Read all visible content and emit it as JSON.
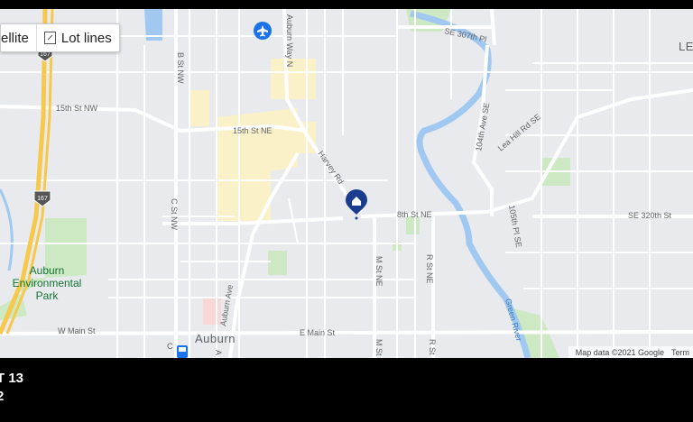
{
  "map": {
    "layer_toggle": {
      "satellite_label": "ellite",
      "lot_lines_label": "Lot lines"
    },
    "streets": {
      "se_307th_pl": "SE 307th Pl",
      "auburn_way_n": "Auburn Way N",
      "b_st_nw": "B St NW",
      "15th_st_nw": "15th St NW",
      "15th_st_ne": "15th St NE",
      "harvey_rd": "Harvey Rd",
      "104th_ave_se": "104th Ave SE",
      "lea_hill_rd_se": "Lea Hill Rd SE",
      "8th_st_ne": "8th St NE",
      "se_320th_st": "SE 320th St",
      "105th_pl_se": "105th Pl SE",
      "c_st_nw": "C St NW",
      "m_st_ne": "M St NE",
      "r_st_ne": "R St NE",
      "auburn_ave": "Auburn Ave",
      "w_main_st": "W Main St",
      "e_main_st": "E Main St",
      "m_st": "M St",
      "r_st": "R St",
      "c_st_partial": "C",
      "a_st_partial": "A"
    },
    "highway_shield": "167",
    "places": {
      "park_line1": "Auburn",
      "park_line2": "Environmental",
      "park_line3": "Park",
      "city": "Auburn",
      "river": "Green River",
      "town_partial": "LE"
    },
    "icons": [
      "airport-icon",
      "home-marker-icon",
      "transit-icon"
    ],
    "attribution": {
      "map_data": "Map data ©2021 Google",
      "terms": "Term"
    }
  },
  "info": {
    "line1": "T 13",
    "line2": "2"
  },
  "colors": {
    "map_bg": "#e8eaed",
    "road": "#ffffff",
    "highway": "#f6c84c",
    "water": "#a0c8f0",
    "park": "#cde9c3",
    "commercial": "#fbf1c9",
    "marker": "#1a3d8f"
  }
}
